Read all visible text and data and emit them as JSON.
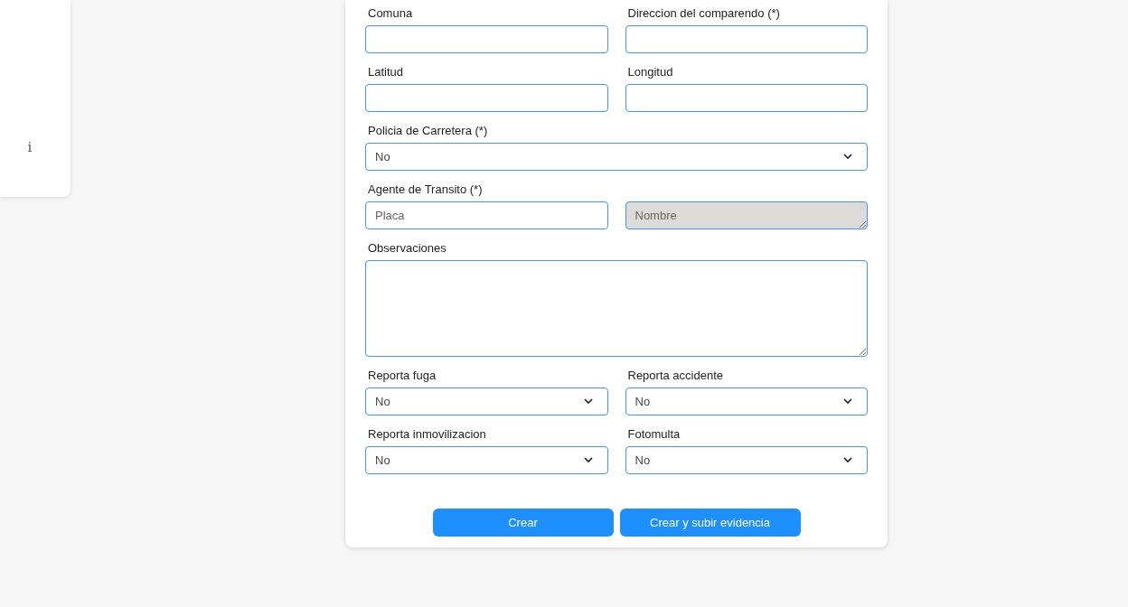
{
  "sidebar": {
    "icon": "i"
  },
  "form": {
    "rows": [
      {
        "groups": [
          {
            "label": "Comuna",
            "inputs": [
              {
                "kind": "text",
                "disabled": false
              }
            ]
          },
          {
            "label": "Direccion del comparendo (*)",
            "inputs": [
              {
                "kind": "text",
                "disabled": false
              }
            ]
          }
        ]
      },
      {
        "groups": [
          {
            "label": "Latitud",
            "inputs": [
              {
                "kind": "text",
                "disabled": false
              }
            ]
          },
          {
            "label": "Longitud",
            "inputs": [
              {
                "kind": "text",
                "disabled": false
              }
            ]
          }
        ]
      },
      {
        "groups": [
          {
            "label": "Policia de Carretera (*)",
            "inputs": [
              {
                "kind": "select",
                "value": "No",
                "disabled": false
              }
            ]
          }
        ]
      },
      {
        "groups": [
          {
            "label": "Agente de Transito (*)",
            "inputs": [
              {
                "kind": "text",
                "placeholder": "Placa",
                "disabled": false
              },
              {
                "kind": "textarea",
                "placeholder": "Nombre",
                "disabled": true
              }
            ]
          }
        ]
      },
      {
        "groups": [
          {
            "label": "Observaciones",
            "inputs": [
              {
                "kind": "textarea",
                "disabled": false
              }
            ]
          }
        ]
      },
      {
        "groups": [
          {
            "label": "Reporta fuga",
            "inputs": [
              {
                "kind": "select",
                "value": "No",
                "disabled": false
              }
            ]
          },
          {
            "label": "Reporta accidente",
            "inputs": [
              {
                "kind": "select",
                "value": "No",
                "disabled": false
              }
            ]
          }
        ]
      },
      {
        "groups": [
          {
            "label": "Reporta inmovilizacion",
            "inputs": [
              {
                "kind": "select",
                "value": "No",
                "disabled": false
              }
            ]
          },
          {
            "label": "Fotomulta",
            "inputs": [
              {
                "kind": "select",
                "value": "No",
                "disabled": false
              }
            ]
          }
        ]
      }
    ]
  },
  "buttons": [
    {
      "label": "Crear"
    },
    {
      "label": "Crear y subir evidencia"
    }
  ]
}
